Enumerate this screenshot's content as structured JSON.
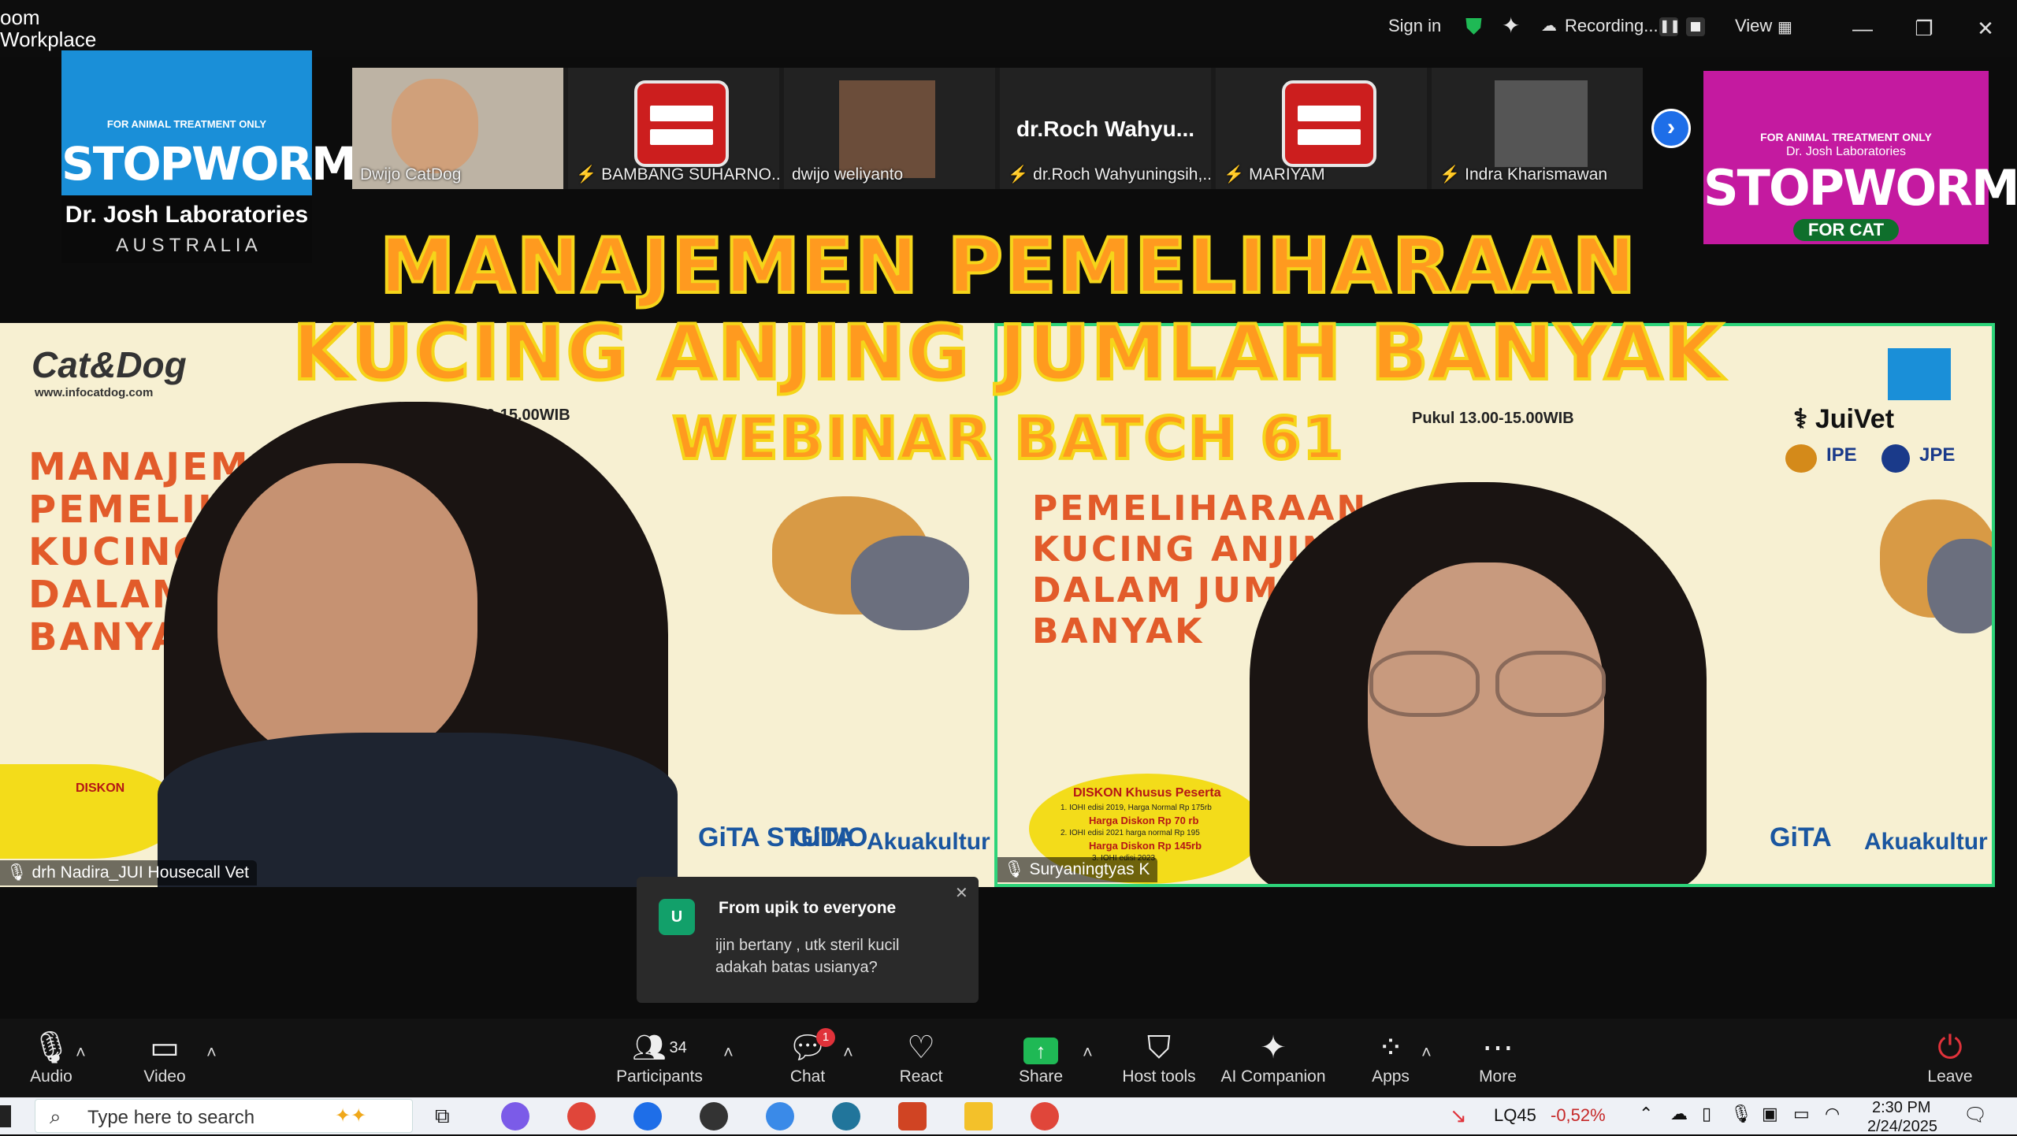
{
  "app": {
    "title": "Zoom Workplace",
    "title_visible": "oom\nWorkplace"
  },
  "topbar": {
    "sign_in": "Sign in",
    "recording": "Recording...",
    "view": "View"
  },
  "participants_strip": [
    {
      "name": "Dwijo CatDog",
      "muted": false
    },
    {
      "name": "BAMBANG SUHARNO...",
      "muted": true
    },
    {
      "name": "dwijo weliyanto",
      "muted": false
    },
    {
      "name": "dr.Roch Wahyuningsih,...",
      "muted": true,
      "display_text": "dr.Roch  Wahyu..."
    },
    {
      "name": "MARIYAM",
      "muted": true
    },
    {
      "name": "Indra Kharismawan",
      "muted": true
    }
  ],
  "banner_left": {
    "top_text": "FOR ANIMAL TREATMENT ONLY",
    "brand": "STOPWORM",
    "lab": "Dr. Josh Laboratories",
    "country": "A U S T R A L I A"
  },
  "banner_right": {
    "top_text": "FOR ANIMAL TREATMENT ONLY",
    "lab": "Dr. Josh Laboratories",
    "brand": "STOPWORM",
    "tag": "FOR CAT"
  },
  "overlay_title": {
    "line1": "MANAJEMEN PEMELIHARAAN",
    "line2": "KUCING ANJING JUMLAH BANYAK",
    "line3": "WEBINAR BATCH 61"
  },
  "video_left": {
    "name": "drh Nadira_JUI Housecall Vet",
    "brand": "Cat&Dog",
    "url": "www.infocatdog.com",
    "time": "Pukul 13.00-15.00WIB",
    "slide_lines": [
      "MANAJEM",
      "PEMELIHA",
      "KUCING A",
      "DALAM JU",
      "BANYAK"
    ],
    "discount": "DISKON",
    "sponsors": [
      "GiTA STUDIO",
      "GiTA",
      "Akuakultur"
    ]
  },
  "video_right": {
    "name": "Suryaningtyas K",
    "time": "Pukul 13.00-15.00WIB",
    "slide_lines": [
      "PEMELIHARAAN",
      "KUCING ANJING",
      "DALAM JUMLAH",
      "BANYAK"
    ],
    "discount_title": "DISKON Khusus Peserta",
    "discount_lines": [
      "1. IOHI edisi 2019, Harga Normal Rp 175rb",
      "Harga Diskon Rp 70 rb",
      "2. IOHI edisi 2021 harga normal Rp 195",
      "Harga Diskon Rp 145rb",
      "3. IOHI edisi 2023"
    ],
    "juivet": "JuiVet",
    "sponsors": [
      "GiTA",
      "Akuakultur"
    ]
  },
  "chat_popup": {
    "avatar_letter": "U",
    "from": "From upik to everyone",
    "message_line1": "ijin bertany , utk steril kucil",
    "message_line2": "adakah batas usianya?"
  },
  "toolbar": {
    "audio": "Audio",
    "video": "Video",
    "participants": "Participants",
    "participants_count": "34",
    "chat": "Chat",
    "chat_badge": "1",
    "react": "React",
    "share": "Share",
    "host_tools": "Host tools",
    "ai_companion": "AI Companion",
    "apps": "Apps",
    "more": "More",
    "leave": "Leave"
  },
  "taskbar": {
    "search_placeholder": "Type here to search",
    "stock_name": "LQ45",
    "stock_change": "-0,52%",
    "time": "2:30 PM",
    "date": "2/24/2025"
  },
  "colors": {
    "title_fill": "#ff9a1f",
    "title_stroke": "#f5d51a",
    "active_speaker_border": "#2ed47a",
    "share_green": "#1fb955",
    "badge_red": "#e0323a"
  }
}
